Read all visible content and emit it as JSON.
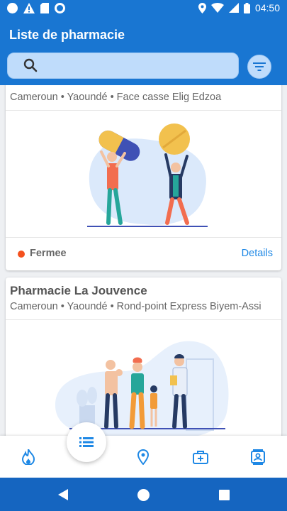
{
  "statusbar": {
    "time": "04:50"
  },
  "appbar": {
    "title": "Liste de pharmacie"
  },
  "search": {
    "placeholder": "",
    "value": ""
  },
  "cards": [
    {
      "name": "",
      "location": "Cameroun • Yaoundé • Face casse Elig Edzoa",
      "status": "Fermee",
      "status_color": "#f4511e",
      "details": "Details"
    },
    {
      "name": "Pharmacie La Jouvence",
      "location": "Cameroun • Yaoundé • Rond-point Express Biyem-Assi"
    }
  ],
  "bottom_nav": {
    "items": [
      "fire-icon",
      "list-icon",
      "location-pin-icon",
      "medical-kit-icon",
      "contact-card-icon"
    ],
    "active": "list-icon"
  },
  "colors": {
    "primary": "#1976d2",
    "accent": "#1e88e5",
    "nav_dark": "#1565c0"
  }
}
